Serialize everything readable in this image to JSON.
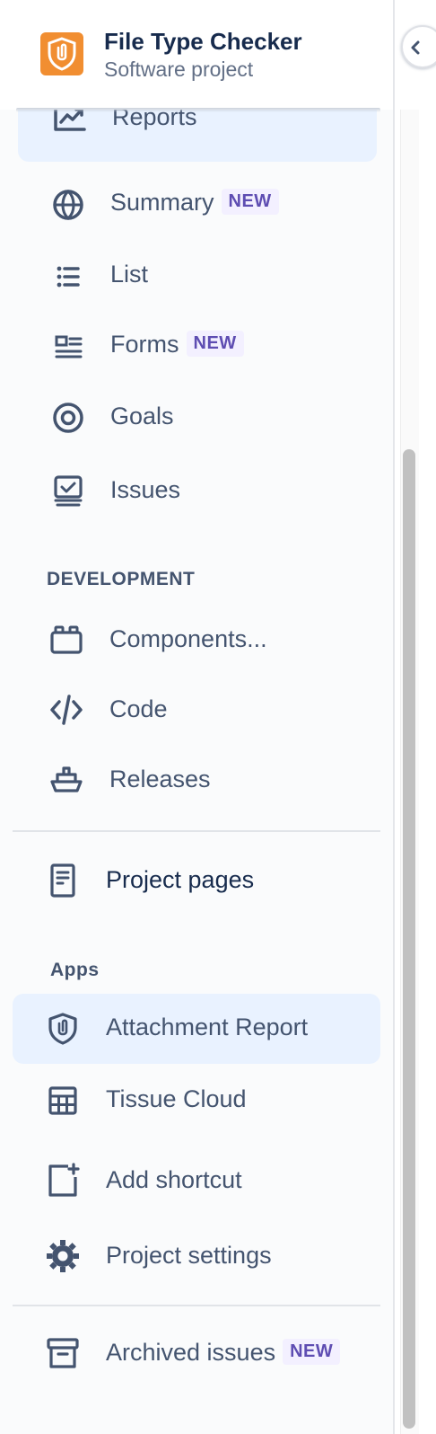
{
  "project": {
    "name": "File Type Checker",
    "type": "Software project",
    "icon": "shield-paperclip-icon",
    "icon_color": "#f18e31"
  },
  "planning": {
    "items": [
      {
        "label": "Reports",
        "icon": "chart-line-icon",
        "selected": true
      },
      {
        "label": "Summary",
        "icon": "globe-icon",
        "badge": "NEW"
      },
      {
        "label": "List",
        "icon": "list-icon"
      },
      {
        "label": "Forms",
        "icon": "form-icon",
        "badge": "NEW"
      },
      {
        "label": "Goals",
        "icon": "target-icon"
      },
      {
        "label": "Issues",
        "icon": "issues-icon"
      }
    ]
  },
  "development": {
    "title": "DEVELOPMENT",
    "items": [
      {
        "label": "Components...",
        "icon": "component-icon"
      },
      {
        "label": "Code",
        "icon": "code-icon"
      },
      {
        "label": "Releases",
        "icon": "ship-icon"
      }
    ]
  },
  "project_pages": {
    "label": "Project pages",
    "icon": "page-icon"
  },
  "apps": {
    "title": "Apps",
    "items": [
      {
        "label": "Attachment Report",
        "icon": "shield-paperclip-icon",
        "selected": true
      },
      {
        "label": "Tissue Cloud",
        "icon": "table-icon"
      }
    ]
  },
  "add_shortcut": {
    "label": "Add shortcut",
    "icon": "add-shortcut-icon"
  },
  "project_settings": {
    "label": "Project settings",
    "icon": "gear-icon"
  },
  "archived": {
    "label": "Archived issues",
    "icon": "archive-icon",
    "badge": "NEW"
  },
  "colors": {
    "selected_bg": "#e9f2ff",
    "text": "#44546f",
    "heading": "#172b4d",
    "badge_bg": "#f3f0ff",
    "badge_text": "#5e4db2"
  }
}
